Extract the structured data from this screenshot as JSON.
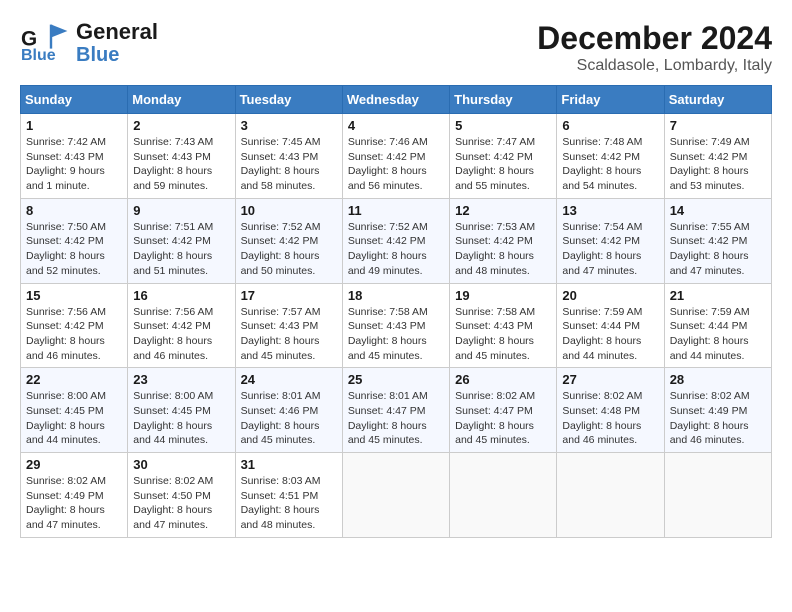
{
  "header": {
    "logo_line1": "General",
    "logo_line2": "Blue",
    "month": "December 2024",
    "location": "Scaldasole, Lombardy, Italy"
  },
  "days_of_week": [
    "Sunday",
    "Monday",
    "Tuesday",
    "Wednesday",
    "Thursday",
    "Friday",
    "Saturday"
  ],
  "weeks": [
    [
      {
        "day": "1",
        "sunrise": "Sunrise: 7:42 AM",
        "sunset": "Sunset: 4:43 PM",
        "daylight": "Daylight: 9 hours and 1 minute."
      },
      {
        "day": "2",
        "sunrise": "Sunrise: 7:43 AM",
        "sunset": "Sunset: 4:43 PM",
        "daylight": "Daylight: 8 hours and 59 minutes."
      },
      {
        "day": "3",
        "sunrise": "Sunrise: 7:45 AM",
        "sunset": "Sunset: 4:43 PM",
        "daylight": "Daylight: 8 hours and 58 minutes."
      },
      {
        "day": "4",
        "sunrise": "Sunrise: 7:46 AM",
        "sunset": "Sunset: 4:42 PM",
        "daylight": "Daylight: 8 hours and 56 minutes."
      },
      {
        "day": "5",
        "sunrise": "Sunrise: 7:47 AM",
        "sunset": "Sunset: 4:42 PM",
        "daylight": "Daylight: 8 hours and 55 minutes."
      },
      {
        "day": "6",
        "sunrise": "Sunrise: 7:48 AM",
        "sunset": "Sunset: 4:42 PM",
        "daylight": "Daylight: 8 hours and 54 minutes."
      },
      {
        "day": "7",
        "sunrise": "Sunrise: 7:49 AM",
        "sunset": "Sunset: 4:42 PM",
        "daylight": "Daylight: 8 hours and 53 minutes."
      }
    ],
    [
      {
        "day": "8",
        "sunrise": "Sunrise: 7:50 AM",
        "sunset": "Sunset: 4:42 PM",
        "daylight": "Daylight: 8 hours and 52 minutes."
      },
      {
        "day": "9",
        "sunrise": "Sunrise: 7:51 AM",
        "sunset": "Sunset: 4:42 PM",
        "daylight": "Daylight: 8 hours and 51 minutes."
      },
      {
        "day": "10",
        "sunrise": "Sunrise: 7:52 AM",
        "sunset": "Sunset: 4:42 PM",
        "daylight": "Daylight: 8 hours and 50 minutes."
      },
      {
        "day": "11",
        "sunrise": "Sunrise: 7:52 AM",
        "sunset": "Sunset: 4:42 PM",
        "daylight": "Daylight: 8 hours and 49 minutes."
      },
      {
        "day": "12",
        "sunrise": "Sunrise: 7:53 AM",
        "sunset": "Sunset: 4:42 PM",
        "daylight": "Daylight: 8 hours and 48 minutes."
      },
      {
        "day": "13",
        "sunrise": "Sunrise: 7:54 AM",
        "sunset": "Sunset: 4:42 PM",
        "daylight": "Daylight: 8 hours and 47 minutes."
      },
      {
        "day": "14",
        "sunrise": "Sunrise: 7:55 AM",
        "sunset": "Sunset: 4:42 PM",
        "daylight": "Daylight: 8 hours and 47 minutes."
      }
    ],
    [
      {
        "day": "15",
        "sunrise": "Sunrise: 7:56 AM",
        "sunset": "Sunset: 4:42 PM",
        "daylight": "Daylight: 8 hours and 46 minutes."
      },
      {
        "day": "16",
        "sunrise": "Sunrise: 7:56 AM",
        "sunset": "Sunset: 4:42 PM",
        "daylight": "Daylight: 8 hours and 46 minutes."
      },
      {
        "day": "17",
        "sunrise": "Sunrise: 7:57 AM",
        "sunset": "Sunset: 4:43 PM",
        "daylight": "Daylight: 8 hours and 45 minutes."
      },
      {
        "day": "18",
        "sunrise": "Sunrise: 7:58 AM",
        "sunset": "Sunset: 4:43 PM",
        "daylight": "Daylight: 8 hours and 45 minutes."
      },
      {
        "day": "19",
        "sunrise": "Sunrise: 7:58 AM",
        "sunset": "Sunset: 4:43 PM",
        "daylight": "Daylight: 8 hours and 45 minutes."
      },
      {
        "day": "20",
        "sunrise": "Sunrise: 7:59 AM",
        "sunset": "Sunset: 4:44 PM",
        "daylight": "Daylight: 8 hours and 44 minutes."
      },
      {
        "day": "21",
        "sunrise": "Sunrise: 7:59 AM",
        "sunset": "Sunset: 4:44 PM",
        "daylight": "Daylight: 8 hours and 44 minutes."
      }
    ],
    [
      {
        "day": "22",
        "sunrise": "Sunrise: 8:00 AM",
        "sunset": "Sunset: 4:45 PM",
        "daylight": "Daylight: 8 hours and 44 minutes."
      },
      {
        "day": "23",
        "sunrise": "Sunrise: 8:00 AM",
        "sunset": "Sunset: 4:45 PM",
        "daylight": "Daylight: 8 hours and 44 minutes."
      },
      {
        "day": "24",
        "sunrise": "Sunrise: 8:01 AM",
        "sunset": "Sunset: 4:46 PM",
        "daylight": "Daylight: 8 hours and 45 minutes."
      },
      {
        "day": "25",
        "sunrise": "Sunrise: 8:01 AM",
        "sunset": "Sunset: 4:47 PM",
        "daylight": "Daylight: 8 hours and 45 minutes."
      },
      {
        "day": "26",
        "sunrise": "Sunrise: 8:02 AM",
        "sunset": "Sunset: 4:47 PM",
        "daylight": "Daylight: 8 hours and 45 minutes."
      },
      {
        "day": "27",
        "sunrise": "Sunrise: 8:02 AM",
        "sunset": "Sunset: 4:48 PM",
        "daylight": "Daylight: 8 hours and 46 minutes."
      },
      {
        "day": "28",
        "sunrise": "Sunrise: 8:02 AM",
        "sunset": "Sunset: 4:49 PM",
        "daylight": "Daylight: 8 hours and 46 minutes."
      }
    ],
    [
      {
        "day": "29",
        "sunrise": "Sunrise: 8:02 AM",
        "sunset": "Sunset: 4:49 PM",
        "daylight": "Daylight: 8 hours and 47 minutes."
      },
      {
        "day": "30",
        "sunrise": "Sunrise: 8:02 AM",
        "sunset": "Sunset: 4:50 PM",
        "daylight": "Daylight: 8 hours and 47 minutes."
      },
      {
        "day": "31",
        "sunrise": "Sunrise: 8:03 AM",
        "sunset": "Sunset: 4:51 PM",
        "daylight": "Daylight: 8 hours and 48 minutes."
      },
      null,
      null,
      null,
      null
    ]
  ]
}
